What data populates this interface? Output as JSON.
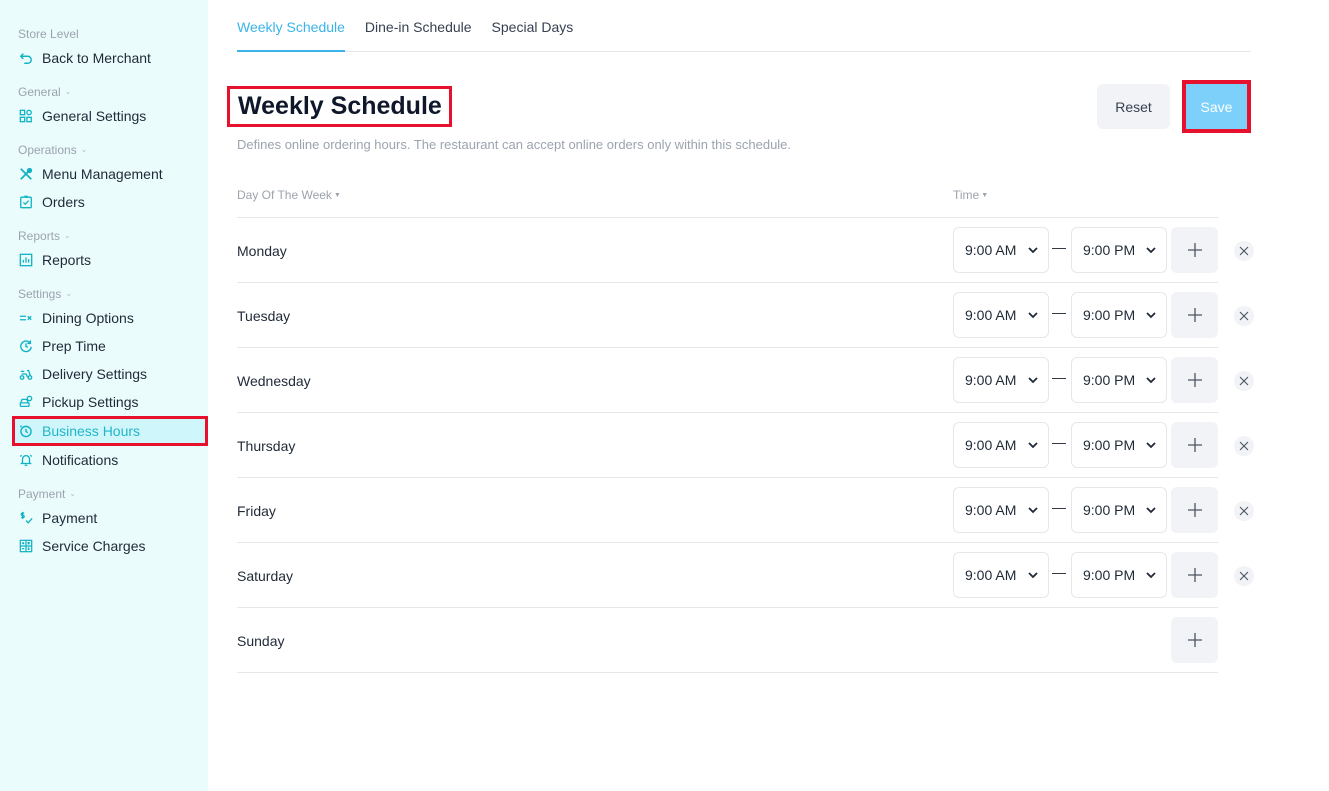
{
  "sidebar": {
    "store_level": {
      "label": "Store Level",
      "items": [
        {
          "label": "Back to Merchant",
          "icon": "back-arrow-icon"
        }
      ]
    },
    "general": {
      "label": "General",
      "items": [
        {
          "label": "General Settings",
          "icon": "grid-settings-icon"
        }
      ]
    },
    "operations": {
      "label": "Operations",
      "items": [
        {
          "label": "Menu Management",
          "icon": "utensils-icon"
        },
        {
          "label": "Orders",
          "icon": "clipboard-check-icon"
        }
      ]
    },
    "reports": {
      "label": "Reports",
      "items": [
        {
          "label": "Reports",
          "icon": "bar-chart-icon"
        }
      ]
    },
    "settings": {
      "label": "Settings",
      "items": [
        {
          "label": "Dining Options",
          "icon": "list-x-icon"
        },
        {
          "label": "Prep Time",
          "icon": "timer-refresh-icon"
        },
        {
          "label": "Delivery Settings",
          "icon": "scooter-icon"
        },
        {
          "label": "Pickup Settings",
          "icon": "car-pin-icon"
        },
        {
          "label": "Business Hours",
          "icon": "clock-icon",
          "active": true
        },
        {
          "label": "Notifications",
          "icon": "bell-icon"
        }
      ]
    },
    "payment": {
      "label": "Payment",
      "items": [
        {
          "label": "Payment",
          "icon": "dollar-check-icon"
        },
        {
          "label": "Service Charges",
          "icon": "calculator-icon"
        }
      ]
    }
  },
  "tabs": [
    {
      "label": "Weekly Schedule",
      "active": true
    },
    {
      "label": "Dine-in Schedule"
    },
    {
      "label": "Special Days"
    }
  ],
  "page": {
    "title": "Weekly Schedule",
    "subtitle": "Defines online ordering hours. The restaurant can accept online orders only within this schedule.",
    "reset_label": "Reset",
    "save_label": "Save"
  },
  "table": {
    "columns": {
      "day": "Day Of The Week",
      "time": "Time"
    },
    "separator": "—",
    "rows": [
      {
        "day": "Monday",
        "start": "9:00 AM",
        "end": "9:00 PM"
      },
      {
        "day": "Tuesday",
        "start": "9:00 AM",
        "end": "9:00 PM"
      },
      {
        "day": "Wednesday",
        "start": "9:00 AM",
        "end": "9:00 PM"
      },
      {
        "day": "Thursday",
        "start": "9:00 AM",
        "end": "9:00 PM"
      },
      {
        "day": "Friday",
        "start": "9:00 AM",
        "end": "9:00 PM"
      },
      {
        "day": "Saturday",
        "start": "9:00 AM",
        "end": "9:00 PM"
      },
      {
        "day": "Sunday",
        "start": null,
        "end": null
      }
    ]
  },
  "colors": {
    "accent": "#3ab4e9",
    "sidebar_bg": "#ebfcfd",
    "sidebar_icon": "#10b3c4",
    "active_bg": "#cff7fb",
    "save_bg": "#7dd0fa",
    "highlight_box": "#e8112d"
  }
}
